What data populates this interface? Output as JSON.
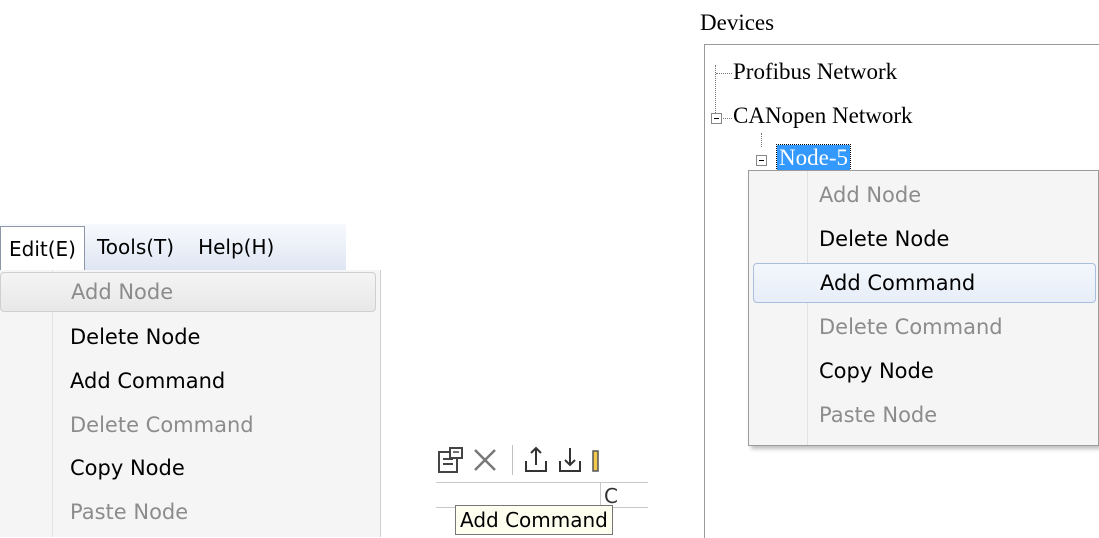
{
  "menubar": {
    "items": [
      {
        "label": "Edit(E)",
        "active": true
      },
      {
        "label": "Tools(T)"
      },
      {
        "label": "Help(H)"
      }
    ]
  },
  "edit_menu": {
    "items": [
      {
        "label": "Add Node",
        "disabled": true
      },
      {
        "label": "Delete Node",
        "disabled": false
      },
      {
        "label": "Add Command",
        "disabled": false
      },
      {
        "label": "Delete Command",
        "disabled": true
      },
      {
        "label": "Copy Node",
        "disabled": false
      },
      {
        "label": "Paste Node",
        "disabled": true
      }
    ]
  },
  "toolbar": {
    "icons": [
      "properties-icon",
      "delete-icon",
      "upload-icon",
      "download-icon"
    ],
    "tooltip": "Add Command",
    "column_header_fragment": "C"
  },
  "devices": {
    "title": "Devices",
    "tree": {
      "profibus": "Profibus Network",
      "canopen": "CANopen Network",
      "node": "Node-5"
    }
  },
  "context_menu": {
    "items": [
      {
        "label": "Add Node",
        "disabled": true
      },
      {
        "label": "Delete Node",
        "disabled": false
      },
      {
        "label": "Add Command",
        "disabled": false
      },
      {
        "label": "Delete Command",
        "disabled": true
      },
      {
        "label": "Copy Node",
        "disabled": false
      },
      {
        "label": "Paste Node",
        "disabled": true
      }
    ]
  },
  "colors": {
    "selection": "#3399ff",
    "disabled_text": "#8c8c8c",
    "menu_bg": "#f5f5f5"
  }
}
